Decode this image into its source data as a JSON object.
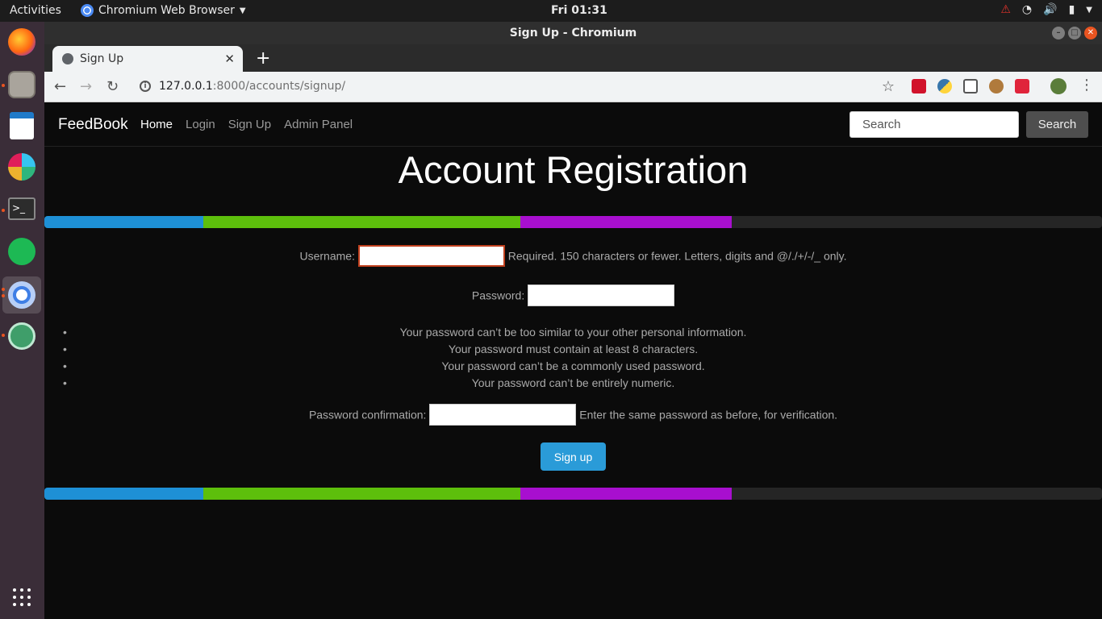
{
  "system": {
    "activities": "Activities",
    "app_menu": "Chromium Web Browser",
    "clock": "Fri 01:31"
  },
  "window": {
    "title": "Sign Up - Chromium"
  },
  "tab": {
    "title": "Sign Up"
  },
  "omnibox": {
    "url_host": "127.0.0.1",
    "url_rest": ":8000/accounts/signup/"
  },
  "navbar": {
    "brand": "FeedBook",
    "links": [
      "Home",
      "Login",
      "Sign Up",
      "Admin Panel"
    ],
    "search_placeholder": "Search",
    "search_button": "Search"
  },
  "main": {
    "heading": "Account Registration",
    "username_label": "Username:",
    "username_help": "Required. 150 characters or fewer. Letters, digits and @/./+/-/_ only.",
    "password_label": "Password:",
    "password_help": [
      "Your password can’t be too similar to your other personal information.",
      "Your password must contain at least 8 characters.",
      "Your password can’t be a commonly used password.",
      "Your password can’t be entirely numeric."
    ],
    "confirm_label": "Password confirmation:",
    "confirm_help": "Enter the same password as before, for verification.",
    "submit": "Sign up"
  },
  "colors": {
    "stripe_blue": "#1e90d6",
    "stripe_green": "#5dbf0c",
    "stripe_purple": "#a80fcf",
    "stripe_dark": "#252525",
    "button": "#2a9bd8"
  }
}
